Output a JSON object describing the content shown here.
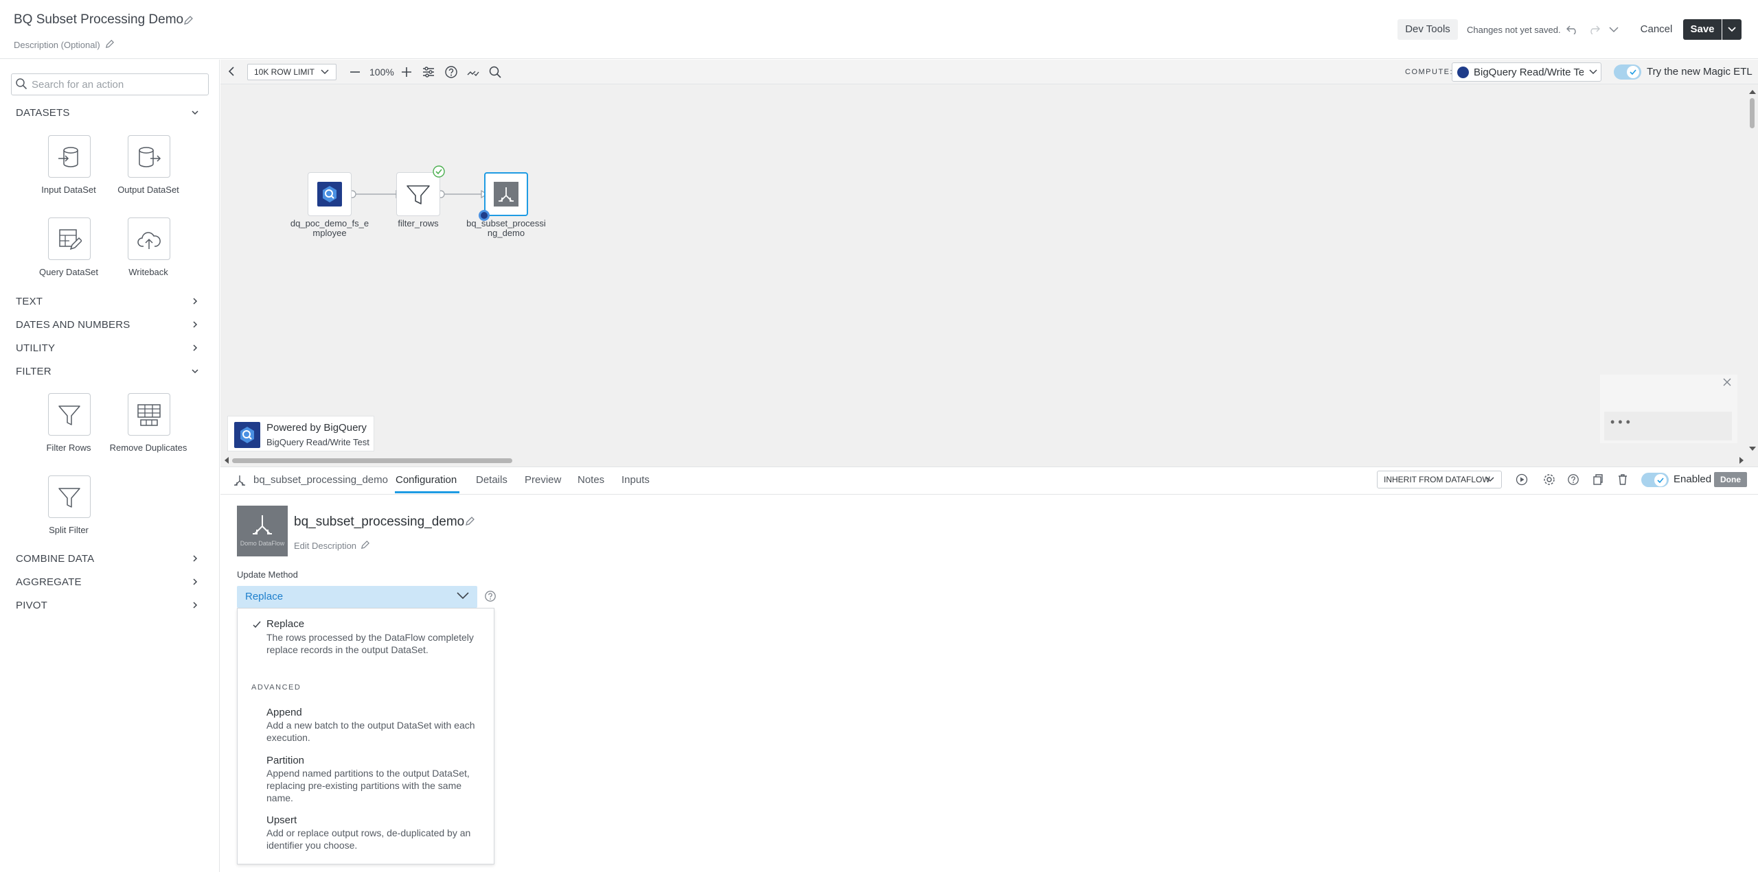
{
  "header": {
    "title": "BQ Subset Processing Demo",
    "description_placeholder": "Description (Optional)",
    "dev_tools": "Dev Tools",
    "status": "Changes not yet saved.",
    "cancel": "Cancel",
    "save": "Save"
  },
  "sidebar": {
    "search_placeholder": "Search for an action",
    "sections": {
      "datasets": "DATASETS",
      "text": "TEXT",
      "dates": "DATES AND NUMBERS",
      "utility": "UTILITY",
      "filter": "FILTER",
      "combine": "COMBINE DATA",
      "aggregate": "AGGREGATE",
      "pivot": "PIVOT"
    },
    "tiles": {
      "input_dataset": "Input DataSet",
      "output_dataset": "Output DataSet",
      "query_dataset": "Query DataSet",
      "writeback": "Writeback",
      "filter_rows": "Filter Rows",
      "remove_duplicates": "Remove Duplicates",
      "split_filter": "Split Filter"
    }
  },
  "canvas": {
    "row_limit": "10K ROW LIMIT",
    "zoom": "100%",
    "compute_label": "COMPUTE:",
    "compute_value": "BigQuery Read/Write Test",
    "magic_etl": "Try the new Magic ETL",
    "nodes": {
      "input": "dq_poc_demo_fs_e\nmployee",
      "filter": "filter_rows",
      "output": "bq_subset_processi\nng_demo"
    },
    "powered_by": "Powered by BigQuery",
    "powered_sub": "BigQuery Read/Write Test",
    "chat_dots": "• • •"
  },
  "panel": {
    "node_name": "bq_subset_processing_demo",
    "tabs": {
      "configuration": "Configuration",
      "details": "Details",
      "preview": "Preview",
      "notes": "Notes",
      "inputs": "Inputs"
    },
    "inherit": "INHERIT FROM DATAFLOW",
    "enabled": "Enabled",
    "done": "Done",
    "icon_caption": "Domo DataFlow",
    "title": "bq_subset_processing_demo",
    "edit_description": "Edit Description",
    "update_method_label": "Update Method",
    "update_method_value": "Replace",
    "advanced": "ADVANCED",
    "options": {
      "replace_title": "Replace",
      "replace_desc": "The rows processed by the DataFlow completely replace records in the output DataSet.",
      "append_title": "Append",
      "append_desc": "Add a new batch to the output DataSet with each execution.",
      "partition_title": "Partition",
      "partition_desc": "Append named partitions to the output DataSet, replacing pre-existing partitions with the same name.",
      "upsert_title": "Upsert",
      "upsert_desc": "Add or replace output rows, de-duplicated by an identifier you choose."
    }
  },
  "colors": {
    "accent": "#1e9be3",
    "dark_button": "#2e3338",
    "select_bg": "#cde6f8",
    "bigquery_blue": "#1f3c8a"
  }
}
